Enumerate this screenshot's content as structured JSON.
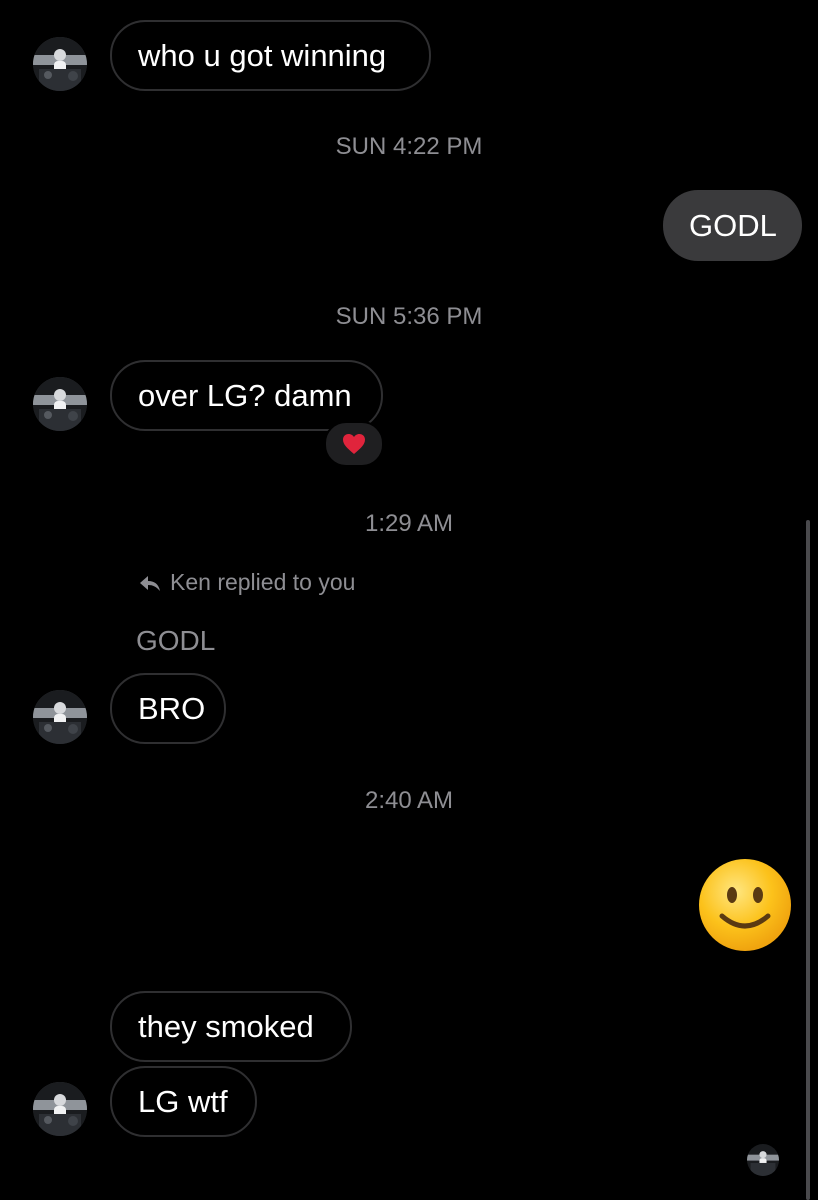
{
  "messages": {
    "m1": "who u got winning",
    "t1": "SUN 4:22 PM",
    "m2": "GODL",
    "t2": "SUN 5:36 PM",
    "m3": "over LG? damn",
    "m3_reaction": "heart",
    "t3": "1:29 AM",
    "reply_header": "Ken replied to you",
    "reply_quote": "GODL",
    "m4": "BRO",
    "t4": "2:40 AM",
    "m5": "slightly-smiling-face",
    "m6": "they smoked",
    "m7": "LG wtf"
  },
  "colors": {
    "background": "#000000",
    "incoming_border": "#2f2f31",
    "outgoing_bubble": "#3a3a3c",
    "timestamp": "#8e8e93"
  }
}
